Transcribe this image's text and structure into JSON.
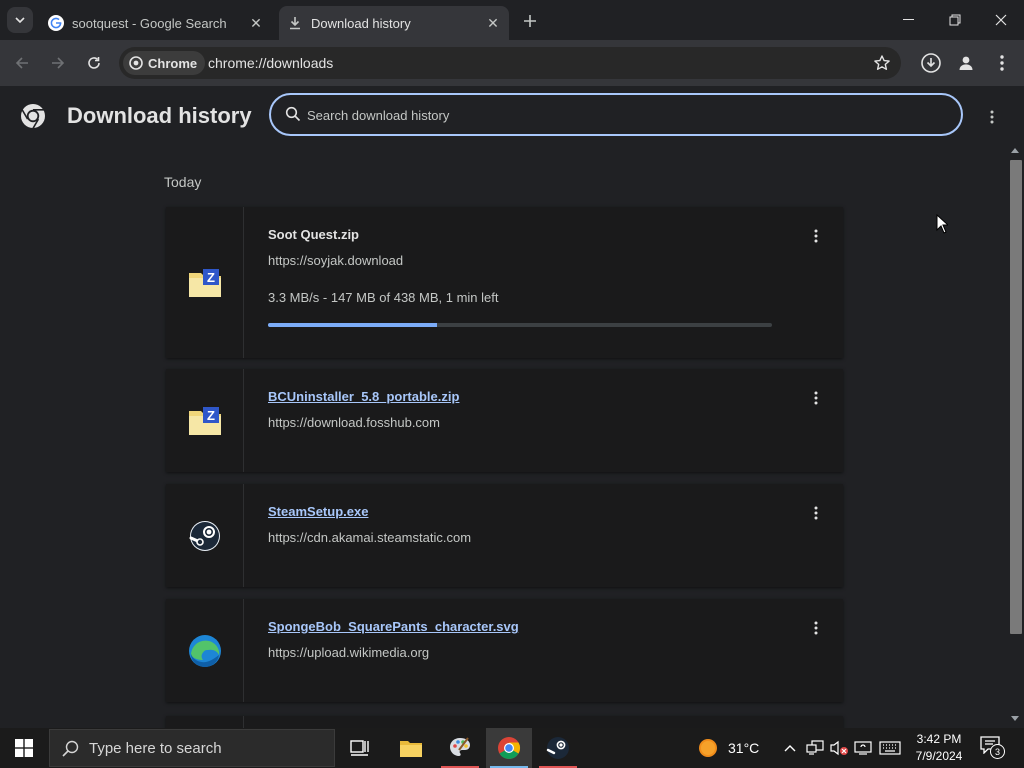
{
  "tabs": [
    {
      "title": "sootquest - Google Search",
      "favicon": "google-g-icon",
      "active": false
    },
    {
      "title": "Download history",
      "favicon": "download-icon",
      "active": true
    }
  ],
  "toolbar": {
    "chip_label": "Chrome",
    "url": "chrome://downloads"
  },
  "page": {
    "title": "Download history",
    "search_placeholder": "Search download history",
    "section_label": "Today"
  },
  "downloads": [
    {
      "filename": "Soot Quest.zip",
      "source": "https://soyjak.download",
      "status": "3.3 MB/s - 147 MB of 438 MB, 1 min left",
      "progress": 0.3356,
      "in_progress": true,
      "icon": "zip-folder-icon"
    },
    {
      "filename": "BCUninstaller_5.8_portable.zip",
      "source": "https://download.fosshub.com",
      "in_progress": false,
      "icon": "zip-folder-icon"
    },
    {
      "filename": "SteamSetup.exe",
      "source": "https://cdn.akamai.steamstatic.com",
      "in_progress": false,
      "icon": "steam-icon"
    },
    {
      "filename": "SpongeBob_SquarePants_character.svg",
      "source": "https://upload.wikimedia.org",
      "in_progress": false,
      "icon": "edge-icon"
    }
  ],
  "taskbar": {
    "search_placeholder": "Type here to search",
    "temperature": "31°C",
    "time": "3:42 PM",
    "date": "7/9/2024",
    "notification_count": "3"
  },
  "colors": {
    "accent": "#a8c7fa",
    "progress": "#7cacf8",
    "page_bg": "#202124",
    "card_bg": "#1a1a1b"
  }
}
